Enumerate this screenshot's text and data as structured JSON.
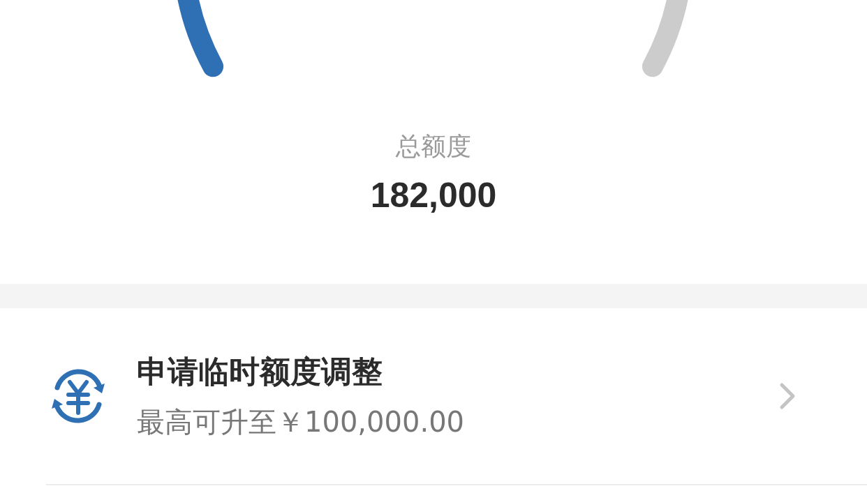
{
  "total": {
    "label": "总额度",
    "value": "182,000"
  },
  "items": [
    {
      "title": "申请临时额度调整",
      "subtitle": "最高可升至￥100,000.00"
    }
  ]
}
